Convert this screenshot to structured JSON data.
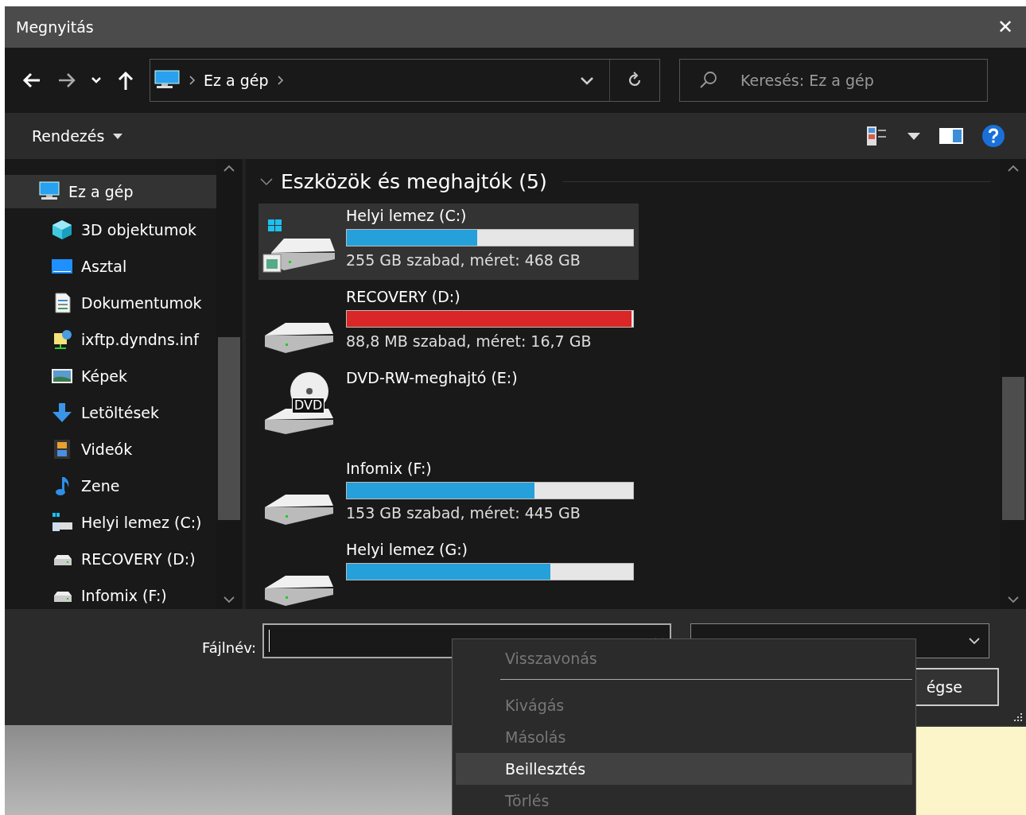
{
  "window": {
    "title": "Megnyitás",
    "close": "✕"
  },
  "nav": {
    "path": [
      "Ez a gép"
    ],
    "search": {
      "placeholder": "Keresés: Ez a gép"
    }
  },
  "toolbar": {
    "organize": "Rendezés"
  },
  "sidebar": {
    "items": [
      {
        "label": "Ez a gép",
        "kind": "pc",
        "selected": true,
        "children": [
          {
            "label": "3D objektumok",
            "kind": "cube",
            "selected": false
          },
          {
            "label": "Asztal",
            "kind": "desktop",
            "selected": false
          },
          {
            "label": "Dokumentumok",
            "kind": "docs",
            "selected": false
          },
          {
            "label": "ixftp.dyndns.inf",
            "kind": "network",
            "selected": false
          },
          {
            "label": "Képek",
            "kind": "pictures",
            "selected": false
          },
          {
            "label": "Letöltések",
            "kind": "download",
            "selected": false
          },
          {
            "label": "Videók",
            "kind": "video",
            "selected": false
          },
          {
            "label": "Zene",
            "kind": "music",
            "selected": false
          },
          {
            "label": "Helyi lemez (C:)",
            "kind": "system",
            "selected": false
          },
          {
            "label": "RECOVERY (D:)",
            "kind": "drive",
            "selected": false
          },
          {
            "label": "Infomix (F:)",
            "kind": "drive",
            "selected": false
          }
        ]
      }
    ]
  },
  "content": {
    "group": {
      "title": "Eszközök és meghajtók (5)",
      "expanded": true
    },
    "drives": [
      {
        "name": "Helyi lemez (C:)",
        "kind": "system",
        "selected": true,
        "level": 0.455,
        "critical": false,
        "info": "255 GB szabad, méret: 468 GB"
      },
      {
        "name": "RECOVERY (D:)",
        "kind": "hdd",
        "selected": false,
        "level": 0.995,
        "critical": true,
        "info": "88,8 MB szabad, méret: 16,7 GB"
      },
      {
        "name": "DVD-RW-meghajtó (E:)",
        "kind": "dvd",
        "selected": false,
        "badge": "DVD"
      },
      {
        "name": "Infomix (F:)",
        "kind": "hdd",
        "selected": false,
        "level": 0.656,
        "critical": false,
        "info": "153 GB szabad, méret: 445 GB"
      },
      {
        "name": "Helyi lemez (G:)",
        "kind": "hdd",
        "selected": false,
        "level": 0.71,
        "critical": false
      }
    ]
  },
  "footer": {
    "filename_label": "Fájlnév:",
    "cancel": "égse"
  },
  "context_menu": {
    "items": [
      {
        "kind": "item",
        "label": "Visszavonás",
        "disabled": true,
        "selected": false
      },
      {
        "kind": "separator"
      },
      {
        "kind": "item",
        "label": "Kivágás",
        "disabled": true,
        "selected": false
      },
      {
        "kind": "item",
        "label": "Másolás",
        "disabled": true,
        "selected": false
      },
      {
        "kind": "item",
        "label": "Beillesztés",
        "disabled": false,
        "selected": true
      },
      {
        "kind": "item",
        "label": "Törlés",
        "disabled": true,
        "selected": false
      }
    ]
  }
}
